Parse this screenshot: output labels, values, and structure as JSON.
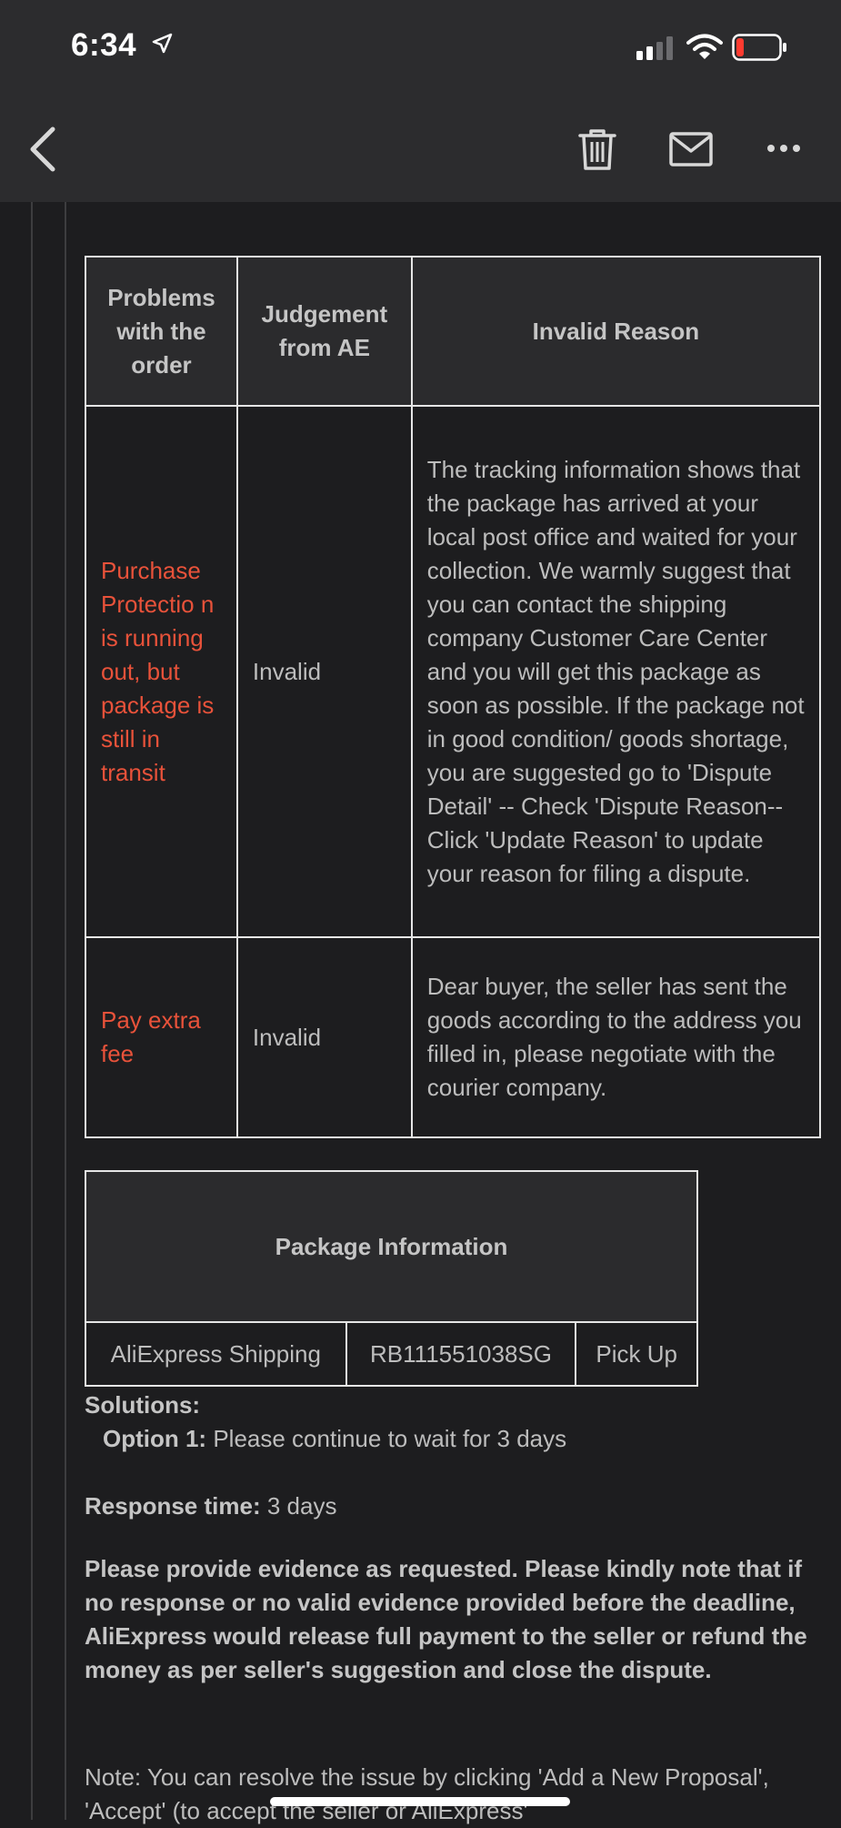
{
  "status": {
    "time": "6:34"
  },
  "nav": {
    "back_icon": "chevron-left-icon",
    "trash_icon": "trash-icon",
    "mail_icon": "mail-icon",
    "more_icon": "more-icon"
  },
  "problems_table": {
    "headers": [
      "Problems with the order",
      "Judgement from AE",
      "Invalid Reason"
    ],
    "rows": [
      {
        "problem": "Purchase Protectio n is running out, but package is still in transit",
        "judgement": "Invalid",
        "reason": "The tracking information shows that the package has arrived at your local post office and waited for your collection. We warmly suggest that you can contact the shipping company Customer Care Center and you will get this package as soon as possible. If the package not in good condition/ goods shortage, you are suggested go to 'Dispute Detail' -- Check 'Dispute Reason-- Click 'Update Reason' to update your reason for filing a dispute."
      },
      {
        "problem": "Pay extra fee",
        "judgement": "Invalid",
        "reason": "Dear buyer, the seller has sent the goods according to the address you filled in, please negotiate with the courier company."
      }
    ]
  },
  "package": {
    "title": "Package Information",
    "shipping": "AliExpress Shipping",
    "tracking": "RB111551038SG",
    "status": "Pick Up"
  },
  "solutions": {
    "label": "Solutions:",
    "option_label": "Option 1:",
    "option_text": "Please continue to wait for 3 days"
  },
  "response": {
    "label": "Response time:",
    "value": "3 days"
  },
  "evidence_text": "Please provide evidence as requested. Please kindly note that if no response or no valid evidence provided before the deadline, AliExpress would release full payment to the seller or refund the money as per seller's suggestion and close the dispute.",
  "note_text": "Note: You can resolve the issue by clicking 'Add a New Proposal', 'Accept' (to accept the seller or AliExpress'",
  "colors": {
    "accent_red": "#e8523a",
    "background": "#1d1d1f",
    "bar": "#2c2c2e"
  }
}
